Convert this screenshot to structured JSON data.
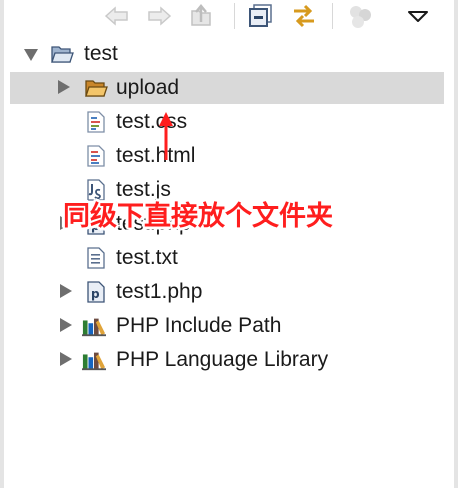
{
  "toolbar": {
    "buttons": [
      {
        "name": "back-button",
        "icon": "arrow-left-icon"
      },
      {
        "name": "forward-button",
        "icon": "arrow-right-icon"
      },
      {
        "name": "up-button",
        "icon": "up-folder-icon"
      },
      {
        "name": "collapse-all-button",
        "icon": "collapse-all-icon"
      },
      {
        "name": "link-with-editor-button",
        "icon": "link-with-editor-icon"
      },
      {
        "name": "focus-button",
        "icon": "focus-icon"
      },
      {
        "name": "view-menu-button",
        "icon": "chevron-down-icon"
      }
    ]
  },
  "tree": {
    "root": {
      "label": "test",
      "expanded": true,
      "icon": "open-folder-icon"
    },
    "items": [
      {
        "label": "upload",
        "icon": "open-folder-icon",
        "expandable": true,
        "selected": true
      },
      {
        "label": "test.css",
        "icon": "css-file-icon",
        "expandable": false
      },
      {
        "label": "test.html",
        "icon": "html-file-icon",
        "expandable": false
      },
      {
        "label": "test.js",
        "icon": "js-file-icon",
        "expandable": false
      },
      {
        "label": "test.php",
        "icon": "php-file-icon",
        "expandable": true
      },
      {
        "label": "test.txt",
        "icon": "text-file-icon",
        "expandable": false
      },
      {
        "label": "test1.php",
        "icon": "php-file-icon",
        "expandable": true
      },
      {
        "label": "PHP Include Path",
        "icon": "library-icon",
        "expandable": true
      },
      {
        "label": "PHP Language Library",
        "icon": "library-icon",
        "expandable": true
      }
    ]
  },
  "annotation": {
    "text": "同级下直接放个文件夹",
    "color": "#ff1e1e"
  },
  "colors": {
    "selection": "#d9d9d9",
    "twisty": "#6e6e6e",
    "folder": "#e8a93a"
  }
}
